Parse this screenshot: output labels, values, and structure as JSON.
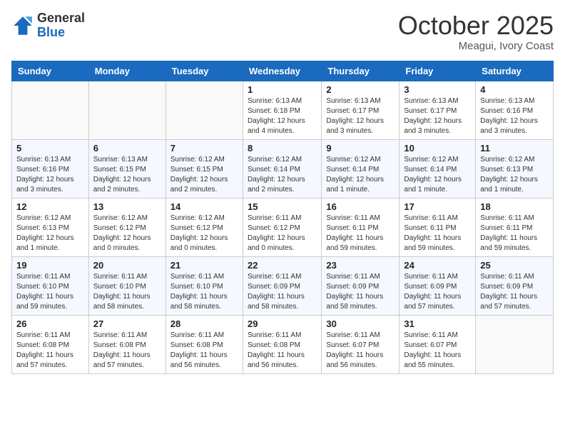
{
  "logo": {
    "general": "General",
    "blue": "Blue"
  },
  "header": {
    "month": "October 2025",
    "location": "Meagui, Ivory Coast"
  },
  "days_of_week": [
    "Sunday",
    "Monday",
    "Tuesday",
    "Wednesday",
    "Thursday",
    "Friday",
    "Saturday"
  ],
  "weeks": [
    [
      {
        "day": "",
        "info": ""
      },
      {
        "day": "",
        "info": ""
      },
      {
        "day": "",
        "info": ""
      },
      {
        "day": "1",
        "info": "Sunrise: 6:13 AM\nSunset: 6:18 PM\nDaylight: 12 hours and 4 minutes."
      },
      {
        "day": "2",
        "info": "Sunrise: 6:13 AM\nSunset: 6:17 PM\nDaylight: 12 hours and 3 minutes."
      },
      {
        "day": "3",
        "info": "Sunrise: 6:13 AM\nSunset: 6:17 PM\nDaylight: 12 hours and 3 minutes."
      },
      {
        "day": "4",
        "info": "Sunrise: 6:13 AM\nSunset: 6:16 PM\nDaylight: 12 hours and 3 minutes."
      }
    ],
    [
      {
        "day": "5",
        "info": "Sunrise: 6:13 AM\nSunset: 6:16 PM\nDaylight: 12 hours and 3 minutes."
      },
      {
        "day": "6",
        "info": "Sunrise: 6:13 AM\nSunset: 6:15 PM\nDaylight: 12 hours and 2 minutes."
      },
      {
        "day": "7",
        "info": "Sunrise: 6:12 AM\nSunset: 6:15 PM\nDaylight: 12 hours and 2 minutes."
      },
      {
        "day": "8",
        "info": "Sunrise: 6:12 AM\nSunset: 6:14 PM\nDaylight: 12 hours and 2 minutes."
      },
      {
        "day": "9",
        "info": "Sunrise: 6:12 AM\nSunset: 6:14 PM\nDaylight: 12 hours and 1 minute."
      },
      {
        "day": "10",
        "info": "Sunrise: 6:12 AM\nSunset: 6:14 PM\nDaylight: 12 hours and 1 minute."
      },
      {
        "day": "11",
        "info": "Sunrise: 6:12 AM\nSunset: 6:13 PM\nDaylight: 12 hours and 1 minute."
      }
    ],
    [
      {
        "day": "12",
        "info": "Sunrise: 6:12 AM\nSunset: 6:13 PM\nDaylight: 12 hours and 1 minute."
      },
      {
        "day": "13",
        "info": "Sunrise: 6:12 AM\nSunset: 6:12 PM\nDaylight: 12 hours and 0 minutes."
      },
      {
        "day": "14",
        "info": "Sunrise: 6:12 AM\nSunset: 6:12 PM\nDaylight: 12 hours and 0 minutes."
      },
      {
        "day": "15",
        "info": "Sunrise: 6:11 AM\nSunset: 6:12 PM\nDaylight: 12 hours and 0 minutes."
      },
      {
        "day": "16",
        "info": "Sunrise: 6:11 AM\nSunset: 6:11 PM\nDaylight: 11 hours and 59 minutes."
      },
      {
        "day": "17",
        "info": "Sunrise: 6:11 AM\nSunset: 6:11 PM\nDaylight: 11 hours and 59 minutes."
      },
      {
        "day": "18",
        "info": "Sunrise: 6:11 AM\nSunset: 6:11 PM\nDaylight: 11 hours and 59 minutes."
      }
    ],
    [
      {
        "day": "19",
        "info": "Sunrise: 6:11 AM\nSunset: 6:10 PM\nDaylight: 11 hours and 59 minutes."
      },
      {
        "day": "20",
        "info": "Sunrise: 6:11 AM\nSunset: 6:10 PM\nDaylight: 11 hours and 58 minutes."
      },
      {
        "day": "21",
        "info": "Sunrise: 6:11 AM\nSunset: 6:10 PM\nDaylight: 11 hours and 58 minutes."
      },
      {
        "day": "22",
        "info": "Sunrise: 6:11 AM\nSunset: 6:09 PM\nDaylight: 11 hours and 58 minutes."
      },
      {
        "day": "23",
        "info": "Sunrise: 6:11 AM\nSunset: 6:09 PM\nDaylight: 11 hours and 58 minutes."
      },
      {
        "day": "24",
        "info": "Sunrise: 6:11 AM\nSunset: 6:09 PM\nDaylight: 11 hours and 57 minutes."
      },
      {
        "day": "25",
        "info": "Sunrise: 6:11 AM\nSunset: 6:09 PM\nDaylight: 11 hours and 57 minutes."
      }
    ],
    [
      {
        "day": "26",
        "info": "Sunrise: 6:11 AM\nSunset: 6:08 PM\nDaylight: 11 hours and 57 minutes."
      },
      {
        "day": "27",
        "info": "Sunrise: 6:11 AM\nSunset: 6:08 PM\nDaylight: 11 hours and 57 minutes."
      },
      {
        "day": "28",
        "info": "Sunrise: 6:11 AM\nSunset: 6:08 PM\nDaylight: 11 hours and 56 minutes."
      },
      {
        "day": "29",
        "info": "Sunrise: 6:11 AM\nSunset: 6:08 PM\nDaylight: 11 hours and 56 minutes."
      },
      {
        "day": "30",
        "info": "Sunrise: 6:11 AM\nSunset: 6:07 PM\nDaylight: 11 hours and 56 minutes."
      },
      {
        "day": "31",
        "info": "Sunrise: 6:11 AM\nSunset: 6:07 PM\nDaylight: 11 hours and 55 minutes."
      },
      {
        "day": "",
        "info": ""
      }
    ]
  ]
}
